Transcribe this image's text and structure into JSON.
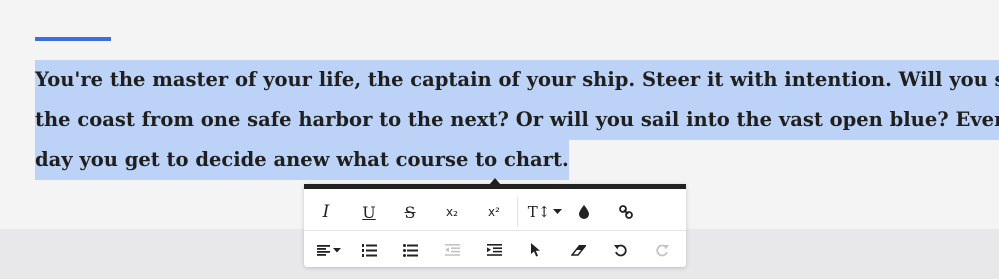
{
  "editor": {
    "lines": [
      "You're the master of your life, the captain of your ship. Steer it with intention. Will you skirt",
      "the coast from one safe harbor to the next? Or will you sail into the vast open blue? Every",
      "day you get to decide anew what course to chart."
    ],
    "selection_color": "#bcd3f7",
    "accent_color": "#3b6fde"
  },
  "toolbar": {
    "row1": [
      {
        "icon": "italic-icon",
        "glyph": "I"
      },
      {
        "icon": "underline-icon",
        "glyph": "U"
      },
      {
        "icon": "strikethrough-icon",
        "glyph": "S"
      },
      {
        "icon": "subscript-icon",
        "glyph": "x₂"
      },
      {
        "icon": "superscript-icon",
        "glyph": "x²"
      },
      {
        "icon": "text-size-icon",
        "glyph": "T↕"
      },
      {
        "icon": "text-color-icon"
      },
      {
        "icon": "link-icon"
      }
    ],
    "row2": [
      {
        "icon": "align-left-icon"
      },
      {
        "icon": "numbered-list-icon"
      },
      {
        "icon": "bulleted-list-icon"
      },
      {
        "icon": "outdent-icon",
        "disabled": true
      },
      {
        "icon": "indent-icon"
      },
      {
        "icon": "cursor-icon"
      },
      {
        "icon": "eraser-icon"
      },
      {
        "icon": "undo-icon"
      },
      {
        "icon": "redo-icon",
        "disabled": true
      }
    ]
  }
}
